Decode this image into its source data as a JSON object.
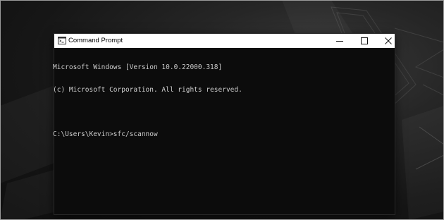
{
  "window": {
    "title": "Command Prompt",
    "icon": "cmd-icon"
  },
  "controls": {
    "minimize_icon": "minimize-icon",
    "maximize_icon": "maximize-icon",
    "close_icon": "close-icon"
  },
  "console": {
    "lines": [
      "Microsoft Windows [Version 10.0.22000.318]",
      "(c) Microsoft Corporation. All rights reserved.",
      "",
      "C:\\Users\\Kevin>sfc/scannow"
    ]
  },
  "colors": {
    "console_bg": "#0c0c0c",
    "console_text": "#cccccc",
    "titlebar_bg": "#ffffff"
  }
}
